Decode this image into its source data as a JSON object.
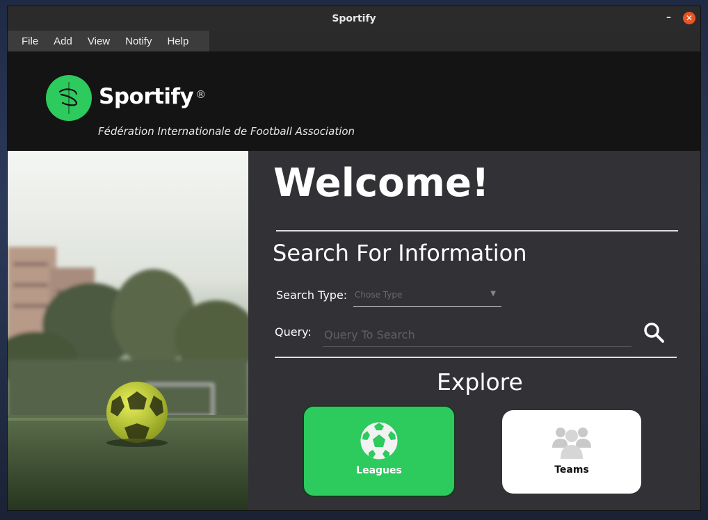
{
  "window": {
    "title": "Sportify"
  },
  "menu": [
    "File",
    "Add",
    "View",
    "Notify",
    "Help"
  ],
  "header": {
    "brand": "Sportify",
    "reg_mark": "®",
    "tagline": "Fédération Internationale de Football Association"
  },
  "main": {
    "welcome": "Welcome!",
    "search_title": "Search For Information",
    "search_type_label": "Search Type:",
    "search_type_placeholder": "Chose Type",
    "query_label": "Query:",
    "query_placeholder": "Query To Search",
    "explore_title": "Explore",
    "cards": [
      {
        "label": "Leagues",
        "icon": "soccer-ball-icon"
      },
      {
        "label": "Teams",
        "icon": "team-group-icon"
      }
    ]
  },
  "colors": {
    "brand_green": "#2dca5e",
    "header_bg": "#141414",
    "panel_bg": "#323236",
    "close_button": "#e95420"
  }
}
